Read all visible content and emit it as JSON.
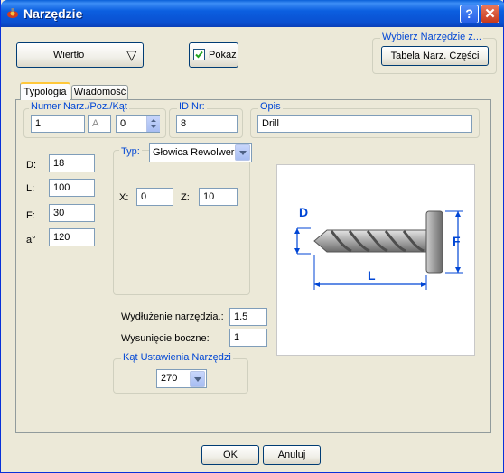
{
  "window": {
    "title": "Narzędzie",
    "help_glyph": "?",
    "close_glyph": "✕"
  },
  "tool_type": {
    "value": "Wiertło",
    "arrow_glyph": "▽"
  },
  "show": {
    "label": "Pokaż",
    "checked": true
  },
  "select_tool": {
    "group_title": "Wybierz Narzędzie z...",
    "button_label": "Tabela Narz. Części"
  },
  "tabs": [
    {
      "label": "Typologia"
    },
    {
      "label": "Wiadomość"
    }
  ],
  "number_group": {
    "title": "Numer Narz./Poz./Kąt",
    "number": "1",
    "position": "A",
    "angle": "0"
  },
  "id_group": {
    "title": "ID Nr:",
    "value": "8"
  },
  "desc_group": {
    "title": "Opis",
    "value": "Drill"
  },
  "dims": [
    {
      "label": "D:",
      "value": "18"
    },
    {
      "label": "L:",
      "value": "100"
    },
    {
      "label": "F:",
      "value": "30"
    },
    {
      "label": "a°",
      "value": "120"
    }
  ],
  "type_group": {
    "title": "Typ:",
    "value": "Głowica Rewolwero",
    "x_label": "X:",
    "x_value": "0",
    "z_label": "Z:",
    "z_value": "10"
  },
  "extension": {
    "label": "Wydłużenie narzędzia.:",
    "value": "1.5"
  },
  "side_offset": {
    "label": "Wysunięcie boczne:",
    "value": "1"
  },
  "angle_group": {
    "title": "Kąt Ustawienia Narzędzi",
    "value": "270"
  },
  "diagram": {
    "d_label": "D",
    "f_label": "F",
    "l_label": "L",
    "dim_color": "#0046d5"
  },
  "footer": {
    "ok": "OK",
    "cancel": "Anuluj"
  }
}
